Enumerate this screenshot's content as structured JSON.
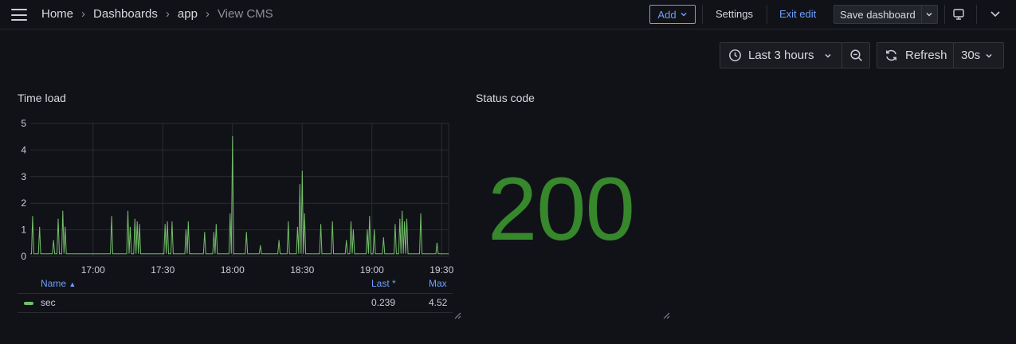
{
  "breadcrumb": [
    "Home",
    "Dashboards",
    "app",
    "View CMS"
  ],
  "toolbar": {
    "add_label": "Add",
    "settings_label": "Settings",
    "exit_edit_label": "Exit edit",
    "save_label": "Save dashboard"
  },
  "time_controls": {
    "time_range": "Last 3 hours",
    "refresh_label": "Refresh",
    "refresh_interval": "30s"
  },
  "panels": {
    "time_load": {
      "title": "Time load",
      "legend": {
        "columns": [
          "Name",
          "Last *",
          "Max"
        ],
        "rows": [
          {
            "name": "sec",
            "last": "0.239",
            "max": "4.52"
          }
        ]
      }
    },
    "status_code": {
      "title": "Status code",
      "value": "200",
      "color": "#37872d"
    }
  },
  "colors": {
    "accent": "#6e9fff",
    "series": "#73bf69",
    "stat_green": "#37872d"
  },
  "chart_data": {
    "type": "line",
    "title": "Time load",
    "xlabel": "",
    "ylabel": "",
    "x_ticks": [
      "17:00",
      "17:30",
      "18:00",
      "18:30",
      "19:00",
      "19:30"
    ],
    "y_ticks": [
      "0",
      "1",
      "2",
      "3",
      "4",
      "5"
    ],
    "ylim": [
      0,
      5
    ],
    "grid": true,
    "legend_placement": "bottom",
    "series": [
      {
        "name": "sec",
        "color": "#73bf69",
        "spikes": [
          [
            "16:34",
            1.5
          ],
          [
            "16:37",
            1.1
          ],
          [
            "16:43",
            0.6
          ],
          [
            "16:45",
            1.4
          ],
          [
            "16:47",
            1.7
          ],
          [
            "16:48",
            1.1
          ],
          [
            "17:08",
            1.5
          ],
          [
            "17:15",
            1.7
          ],
          [
            "17:16",
            1.1
          ],
          [
            "17:18",
            1.4
          ],
          [
            "17:19",
            1.3
          ],
          [
            "17:20",
            1.2
          ],
          [
            "17:31",
            1.2
          ],
          [
            "17:32",
            1.3
          ],
          [
            "17:34",
            1.3
          ],
          [
            "17:40",
            1.0
          ],
          [
            "17:41",
            1.3
          ],
          [
            "17:48",
            0.9
          ],
          [
            "17:52",
            0.9
          ],
          [
            "17:53",
            1.2
          ],
          [
            "17:59",
            1.6
          ],
          [
            "18:00",
            4.5
          ],
          [
            "18:06",
            0.9
          ],
          [
            "18:12",
            0.4
          ],
          [
            "18:20",
            0.6
          ],
          [
            "18:24",
            1.3
          ],
          [
            "18:28",
            1.1
          ],
          [
            "18:29",
            2.7
          ],
          [
            "18:30",
            3.2
          ],
          [
            "18:31",
            1.6
          ],
          [
            "18:38",
            1.2
          ],
          [
            "18:43",
            1.3
          ],
          [
            "18:49",
            0.6
          ],
          [
            "18:51",
            1.3
          ],
          [
            "18:52",
            1.0
          ],
          [
            "18:58",
            1.0
          ],
          [
            "18:59",
            1.5
          ],
          [
            "19:01",
            1.0
          ],
          [
            "19:05",
            0.7
          ],
          [
            "19:10",
            1.2
          ],
          [
            "19:12",
            1.4
          ],
          [
            "19:13",
            1.7
          ],
          [
            "19:14",
            1.3
          ],
          [
            "19:15",
            1.4
          ],
          [
            "19:21",
            1.6
          ],
          [
            "19:28",
            0.5
          ]
        ],
        "baseline": 0.1,
        "last": 0.239,
        "max": 4.52
      }
    ]
  }
}
